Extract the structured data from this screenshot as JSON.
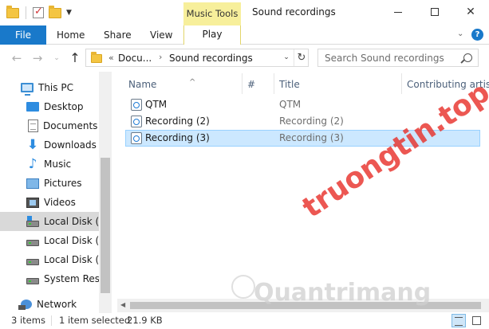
{
  "window": {
    "title": "Sound recordings",
    "context_tab_group": "Music Tools"
  },
  "ribbon": {
    "tabs": [
      "File",
      "Home",
      "Share",
      "View",
      "Play"
    ]
  },
  "address_bar": {
    "prefix": "«",
    "segments": [
      "Docu...",
      "Sound recordings"
    ]
  },
  "search": {
    "placeholder": "Search Sound recordings"
  },
  "sidebar": {
    "items": [
      {
        "label": "This PC",
        "icon": "pc-icon"
      },
      {
        "label": "Desktop",
        "icon": "desktop-icon"
      },
      {
        "label": "Documents",
        "icon": "documents-icon"
      },
      {
        "label": "Downloads",
        "icon": "downloads-icon"
      },
      {
        "label": "Music",
        "icon": "music-icon"
      },
      {
        "label": "Pictures",
        "icon": "pictures-icon"
      },
      {
        "label": "Videos",
        "icon": "videos-icon"
      },
      {
        "label": "Local Disk (C",
        "icon": "disk-icon"
      },
      {
        "label": "Local Disk (D",
        "icon": "disk-icon"
      },
      {
        "label": "Local Disk (E:",
        "icon": "disk-icon"
      },
      {
        "label": "System Reser",
        "icon": "disk-icon"
      },
      {
        "label": "Network",
        "icon": "network-icon"
      }
    ]
  },
  "columns": [
    "Name",
    "#",
    "Title",
    "Contributing artists"
  ],
  "files": [
    {
      "name": "QTM",
      "title": "QTM"
    },
    {
      "name": "Recording (2)",
      "title": "Recording (2)"
    },
    {
      "name": "Recording (3)",
      "title": "Recording (3)"
    }
  ],
  "status": {
    "item_count": "3 items",
    "selection": "1 item selected",
    "size": "21.9 KB"
  },
  "watermark": {
    "main": "truongtin.top",
    "sub": "Quantrimang"
  },
  "colors": {
    "file_tab": "#1979ca",
    "music_tools": "#f7ef9b",
    "selection": "#cce8ff",
    "watermark": "#e8332d"
  }
}
